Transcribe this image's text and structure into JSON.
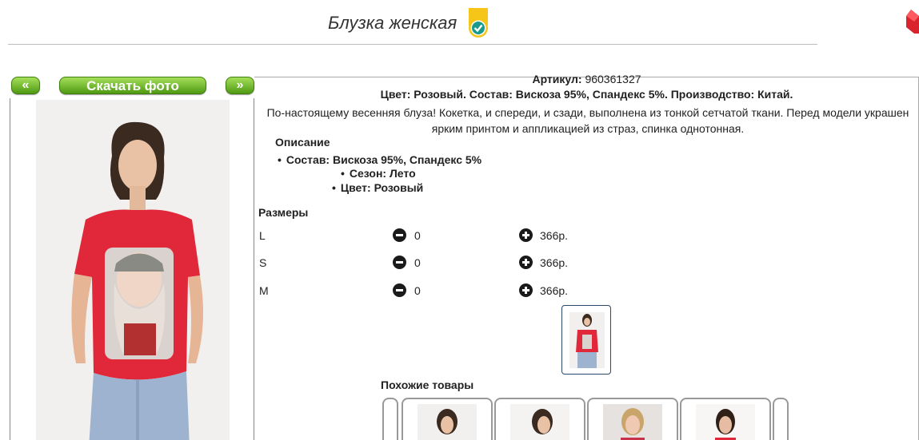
{
  "header": {
    "title": "Блузка женская"
  },
  "nav": {
    "prev_label": "«",
    "download_label": "Скачать фото",
    "next_label": "»"
  },
  "product": {
    "sku_label": "Артикул:",
    "sku_value": "960361327",
    "summary": "Цвет: Розовый. Состав: Вискоза 95%, Спандекс 5%. Производство: Китай.",
    "description": "По-настоящему весенняя блуза! Кокетка, и спереди, и сзади, выполнена из тонкой сетчатой ткани. Перед модели украшен ярким принтом и аппликацией из страз, спинка однотонная.",
    "desc_heading": "Описание",
    "attributes": [
      "Состав: Вискоза 95%, Спандекс 5%",
      "Сезон: Лето",
      "Цвет: Розовый"
    ]
  },
  "sizes": {
    "heading": "Размеры",
    "rows": [
      {
        "size": "L",
        "qty": "0",
        "price": "366р."
      },
      {
        "size": "S",
        "qty": "0",
        "price": "366р."
      },
      {
        "size": "M",
        "qty": "0",
        "price": "366р."
      }
    ]
  },
  "similar": {
    "heading": "Похожие товары"
  },
  "colors": {
    "button_green": "#5aa81c",
    "badge_yellow": "#f5c518",
    "badge_check": "#1a9a8a",
    "close_red": "#d9232d",
    "shirt_red": "#e0283a"
  },
  "icons": {
    "badge": "verified-badge-icon",
    "close": "close-icon",
    "minus": "minus-circle-icon",
    "plus": "plus-circle-icon"
  }
}
